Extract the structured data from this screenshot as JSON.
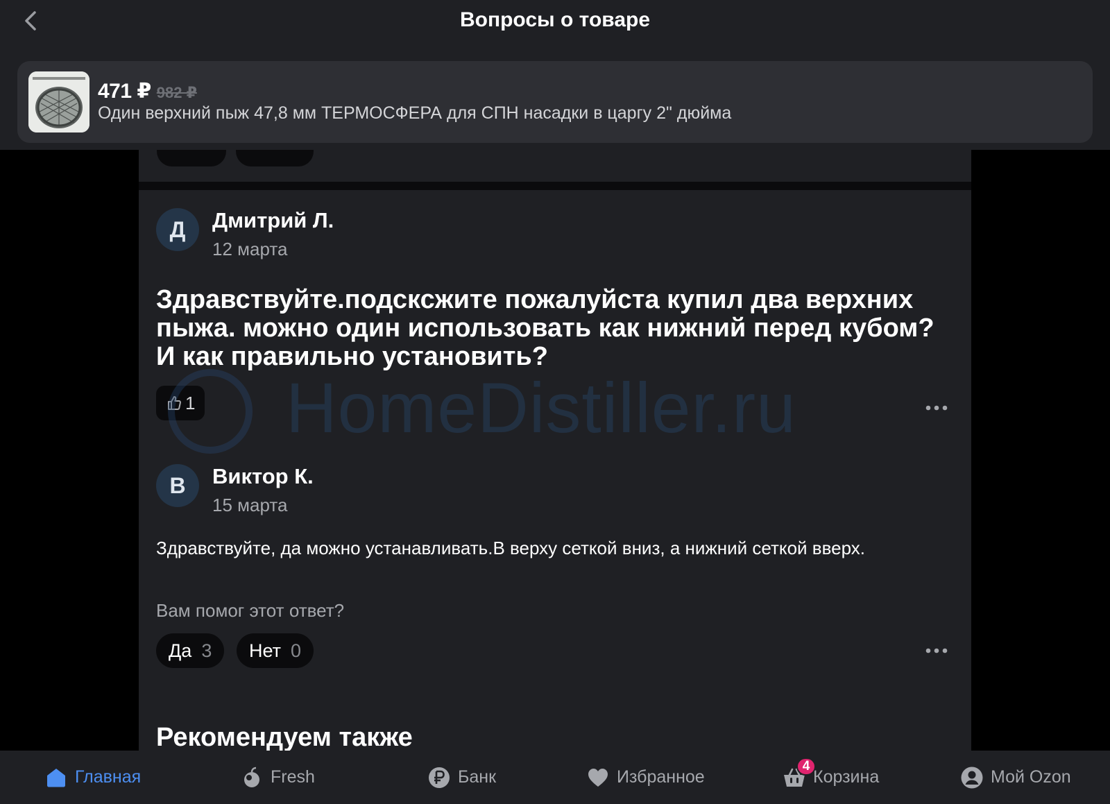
{
  "header": {
    "title": "Вопросы о товаре"
  },
  "product": {
    "price": "471 ₽",
    "old_price": "982 ₽",
    "name": "Один верхний пыж 47,8 мм ТЕРМОСФЕРА для СПН насадки в царгу 2\" дюйма"
  },
  "question": {
    "avatar_letter": "Д",
    "author": "Дмитрий Л.",
    "date": "12 марта",
    "text": "Здравствуйте.подсксжите пожалуйста купил два верхних пыжа. можно один использовать как нижний перед кубом? И как правильно установить?",
    "likes": "1"
  },
  "answer": {
    "avatar_letter": "В",
    "author": "Виктор К.",
    "date": "15 марта",
    "text": "Здравствуйте, да можно устанавливать.В верху сеткой вниз, а нижний сеткой вверх.",
    "helpful_prompt": "Вам помог этот ответ?",
    "yes_label": "Да",
    "yes_count": "3",
    "no_label": "Нет",
    "no_count": "0"
  },
  "recommend_title": "Рекомендуем также",
  "watermark": "HomeDistiller.ru",
  "nav": {
    "items": [
      {
        "label": "Главная",
        "icon": "home-icon"
      },
      {
        "label": "Fresh",
        "icon": "fresh-icon"
      },
      {
        "label": "Банк",
        "icon": "ruble-icon"
      },
      {
        "label": "Избранное",
        "icon": "heart-icon"
      },
      {
        "label": "Корзина",
        "icon": "cart-icon",
        "badge": "4"
      },
      {
        "label": "Мой Ozon",
        "icon": "profile-icon"
      }
    ]
  },
  "colors": {
    "accent": "#4d8ff2",
    "badge": "#e0246e",
    "surface": "#1f2024",
    "background": "#000000"
  }
}
